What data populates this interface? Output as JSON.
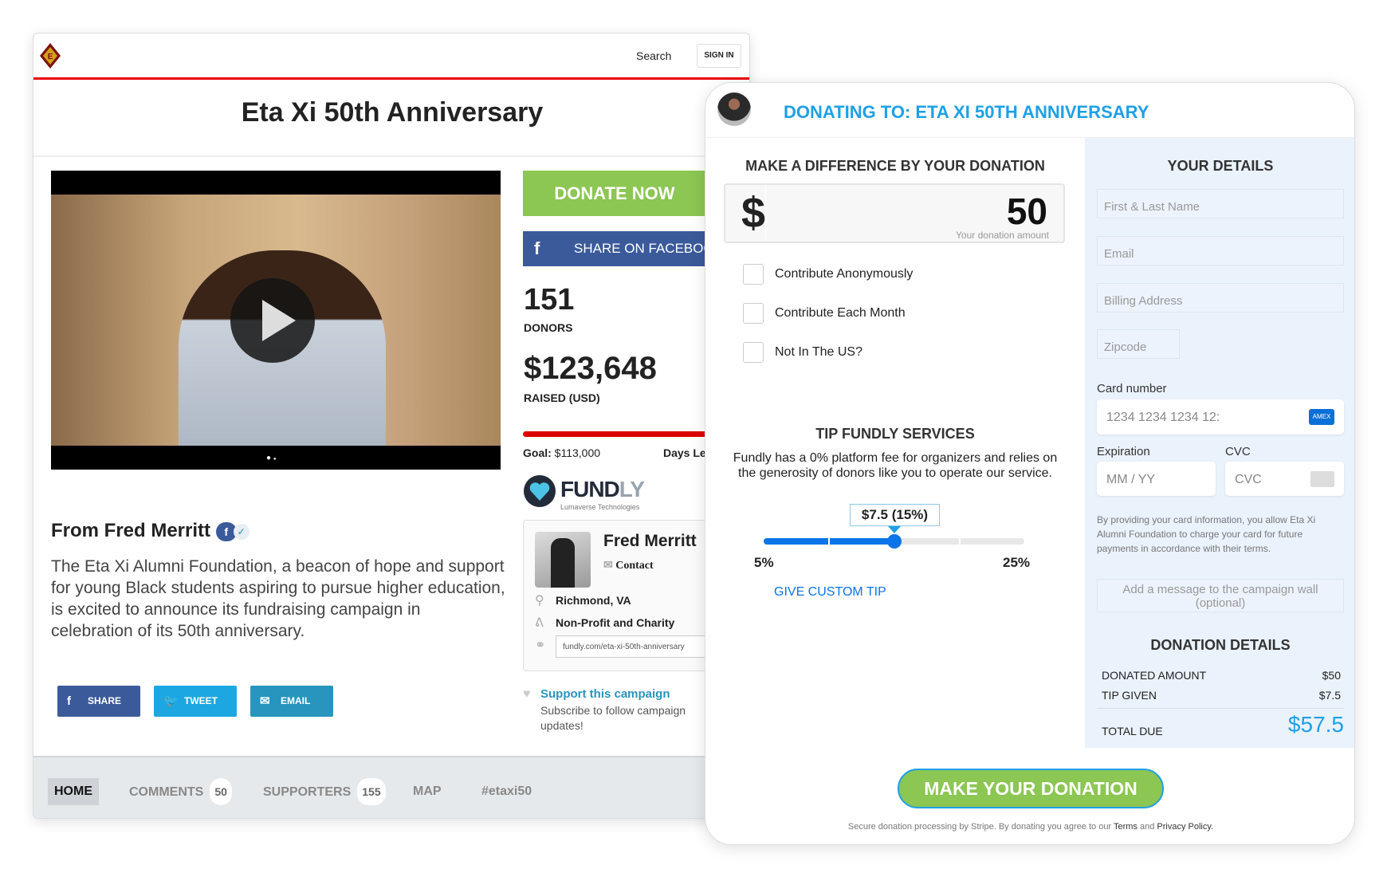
{
  "campaign": {
    "header": {
      "search": "Search",
      "sign_in": "SIGN IN"
    },
    "title": "Eta Xi 50th Anniversary",
    "donate_now": "DONATE NOW",
    "share_facebook": "SHARE ON FACEBOOK",
    "donors_count": "151",
    "donors_label": "DONORS",
    "raised": "$123,648",
    "raised_label": "RAISED (USD)",
    "progress_percent": 100,
    "goal_label": "Goal:",
    "goal_value": "$113,000",
    "days_left": "Days Lef",
    "fundly": {
      "brand_a": "FUND",
      "brand_b": "LY",
      "tagline": "Lumaverse Technologies"
    },
    "organizer": {
      "name": "Fred Merritt",
      "contact": "Contact",
      "location": "Richmond, VA",
      "category": "Non-Profit and Charity",
      "url": "fundly.com/eta-xi-50th-anniversary"
    },
    "from_heading": "From Fred Merritt",
    "description": "The Eta Xi Alumni Foundation, a beacon of hope and support for young Black students aspiring to pursue higher education, is excited to announce its fundraising campaign in celebration of its 50th anniversary.",
    "share": {
      "share": "SHARE",
      "tweet": "TWEET",
      "email": "EMAIL"
    },
    "support": {
      "title": "Support this campaign",
      "text": "Subscribe to follow campaign updates!"
    },
    "tabs": [
      {
        "label": "HOME"
      },
      {
        "label": "COMMENTS",
        "count": "50"
      },
      {
        "label": "SUPPORTERS",
        "count": "155"
      },
      {
        "label": "MAP"
      },
      {
        "label": "#etaxi50"
      }
    ]
  },
  "modal": {
    "title": "DONATING TO: ETA XI 50TH ANNIVERSARY",
    "make_difference": "MAKE A DIFFERENCE BY YOUR DONATION",
    "currency": "$",
    "amount": "50",
    "amount_hint": "Your donation amount",
    "options": [
      "Contribute Anonymously",
      "Contribute Each Month",
      "Not In The US?"
    ],
    "tip": {
      "heading": "TIP FUNDLY SERVICES",
      "text": "Fundly has a 0% platform fee for organizers and relies on the generosity of donors like you to operate our service.",
      "value": "$7.5 (15%)",
      "percent": 15,
      "min": "5%",
      "max": "25%",
      "custom": "GIVE CUSTOM TIP"
    },
    "details": {
      "heading": "YOUR DETAILS",
      "name_ph": "First & Last Name",
      "email_ph": "Email",
      "billing_ph": "Billing Address",
      "zip_ph": "Zipcode",
      "card_label": "Card number",
      "card_ph": "1234 1234 1234 12:",
      "exp_label": "Expiration",
      "exp_ph": "MM / YY",
      "cvc_label": "CVC",
      "cvc_ph": "CVC",
      "legal": "By providing your card information, you allow Eta Xi Alumni Foundation to charge your card for future payments in accordance with their terms.",
      "message_ph": "Add a message to the campaign wall (optional)"
    },
    "summary": {
      "heading": "DONATION DETAILS",
      "donated_label": "DONATED AMOUNT",
      "donated": "$50",
      "tip_label": "TIP GIVEN",
      "tip": "$7.5",
      "total_label": "TOTAL DUE",
      "total": "$57.5"
    },
    "submit": "MAKE YOUR DONATION",
    "footer": {
      "text": "Secure donation processing by Stripe. By donating you agree to our ",
      "terms": "Terms",
      "and": " and ",
      "privacy": "Privacy Policy."
    }
  },
  "colors": {
    "accent": "#1ea0e6",
    "green": "#8cc653",
    "facebook": "#3b5a9a",
    "twitter": "#1ca7e3",
    "email": "#2795bd",
    "red": "#dd0000"
  }
}
